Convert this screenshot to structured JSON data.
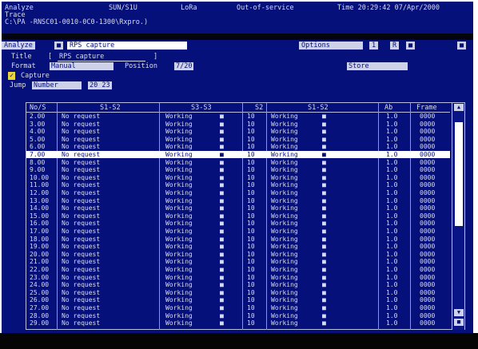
{
  "status": {
    "mode": "Analyze",
    "product": "SUN/S1U",
    "lcd": "LoRa",
    "service": "Out-of-service",
    "time": "Time 20:29:42 07/Apr/2000"
  },
  "trace": {
    "label": "Trace",
    "path": "C:\\PA -RNSC01-0010-0C0-1300\\Rxpro.)"
  },
  "control": {
    "analyze_label": "Analyze",
    "analyze_value": "RPS capture",
    "r_label": "R",
    "options_label": "Options",
    "page_label": "1",
    "title_label": "Title",
    "title_value": "RPS capture",
    "format_label": "Format",
    "format_value": "Manual",
    "position_label": "Position",
    "position_value": "7/20",
    "store_label": "Store",
    "capture_icon": "checkbox-icon",
    "capture_label": "Capture",
    "jump_label": "Jump",
    "jump_value": "Number",
    "jump_number": "20 23"
  },
  "table": {
    "headers": [
      "No/S",
      "S1-S2",
      "S3-S3",
      "S2",
      "S1-S2",
      "Ab",
      "Frame"
    ],
    "rows": [
      {
        "no": "2.00",
        "msg": "No request",
        "st1": "Working",
        "s2": "10",
        "st2": "Working",
        "ab": "1.0",
        "frame": "0000"
      },
      {
        "no": "3.00",
        "msg": "No request",
        "st1": "Working",
        "s2": "10",
        "st2": "Working",
        "ab": "1.0",
        "frame": "0000"
      },
      {
        "no": "4.00",
        "msg": "No request",
        "st1": "Working",
        "s2": "10",
        "st2": "Working",
        "ab": "1.0",
        "frame": "0000"
      },
      {
        "no": "5.00",
        "msg": "No request",
        "st1": "Working",
        "s2": "10",
        "st2": "Working",
        "ab": "1.0",
        "frame": "0000"
      },
      {
        "no": "6.00",
        "msg": "No request",
        "st1": "Working",
        "s2": "10",
        "st2": "Working",
        "ab": "1.0",
        "frame": "0000"
      },
      {
        "no": "7.00",
        "msg": "No request",
        "st1": "Working",
        "s2": "10",
        "st2": "Working",
        "ab": "1.0",
        "frame": "0000",
        "selected": true
      },
      {
        "no": "8.00",
        "msg": "No request",
        "st1": "Working",
        "s2": "10",
        "st2": "Working",
        "ab": "1.0",
        "frame": "0000"
      },
      {
        "no": "9.00",
        "msg": "No request",
        "st1": "Working",
        "s2": "10",
        "st2": "Working",
        "ab": "1.0",
        "frame": "0000"
      },
      {
        "no": "10.00",
        "msg": "No request",
        "st1": "Working",
        "s2": "10",
        "st2": "Working",
        "ab": "1.0",
        "frame": "0000"
      },
      {
        "no": "11.00",
        "msg": "No request",
        "st1": "Working",
        "s2": "10",
        "st2": "Working",
        "ab": "1.0",
        "frame": "0000"
      },
      {
        "no": "12.00",
        "msg": "No request",
        "st1": "Working",
        "s2": "10",
        "st2": "Working",
        "ab": "1.0",
        "frame": "0000"
      },
      {
        "no": "13.00",
        "msg": "No request",
        "st1": "Working",
        "s2": "10",
        "st2": "Working",
        "ab": "1.0",
        "frame": "0000"
      },
      {
        "no": "14.00",
        "msg": "No request",
        "st1": "Working",
        "s2": "10",
        "st2": "Working",
        "ab": "1.0",
        "frame": "0000"
      },
      {
        "no": "15.00",
        "msg": "No request",
        "st1": "Working",
        "s2": "10",
        "st2": "Working",
        "ab": "1.0",
        "frame": "0000"
      },
      {
        "no": "16.00",
        "msg": "No request",
        "st1": "Working",
        "s2": "10",
        "st2": "Working",
        "ab": "1.0",
        "frame": "0000"
      },
      {
        "no": "17.00",
        "msg": "No request",
        "st1": "Working",
        "s2": "10",
        "st2": "Working",
        "ab": "1.0",
        "frame": "0000"
      },
      {
        "no": "18.00",
        "msg": "No request",
        "st1": "Working",
        "s2": "10",
        "st2": "Working",
        "ab": "1.0",
        "frame": "0000"
      },
      {
        "no": "19.00",
        "msg": "No request",
        "st1": "Working",
        "s2": "10",
        "st2": "Working",
        "ab": "1.0",
        "frame": "0000"
      },
      {
        "no": "20.00",
        "msg": "No request",
        "st1": "Working",
        "s2": "10",
        "st2": "Working",
        "ab": "1.0",
        "frame": "0000"
      },
      {
        "no": "21.00",
        "msg": "No request",
        "st1": "Working",
        "s2": "10",
        "st2": "Working",
        "ab": "1.0",
        "frame": "0000"
      },
      {
        "no": "22.00",
        "msg": "No request",
        "st1": "Working",
        "s2": "10",
        "st2": "Working",
        "ab": "1.0",
        "frame": "0000"
      },
      {
        "no": "23.00",
        "msg": "No request",
        "st1": "Working",
        "s2": "10",
        "st2": "Working",
        "ab": "1.0",
        "frame": "0000"
      },
      {
        "no": "24.00",
        "msg": "No request",
        "st1": "Working",
        "s2": "10",
        "st2": "Working",
        "ab": "1.0",
        "frame": "0000"
      },
      {
        "no": "25.00",
        "msg": "No request",
        "st1": "Working",
        "s2": "10",
        "st2": "Working",
        "ab": "1.0",
        "frame": "0000"
      },
      {
        "no": "26.00",
        "msg": "No request",
        "st1": "Working",
        "s2": "10",
        "st2": "Working",
        "ab": "1.0",
        "frame": "0000"
      },
      {
        "no": "27.00",
        "msg": "No request",
        "st1": "Working",
        "s2": "10",
        "st2": "Working",
        "ab": "1.0",
        "frame": "0000"
      },
      {
        "no": "28.00",
        "msg": "No request",
        "st1": "Working",
        "s2": "10",
        "st2": "Working",
        "ab": "1.0",
        "frame": "0000"
      },
      {
        "no": "29.00",
        "msg": "No request",
        "st1": "Working",
        "s2": "10",
        "st2": "Working",
        "ab": "1.0",
        "frame": "0000"
      }
    ]
  },
  "scrollbar": {
    "up_icon": "arrow-up-icon",
    "down_icon": "arrow-down-icon"
  },
  "colors": {
    "screen_bg": "#06107a",
    "text": "#d8dcf0",
    "highlight": "#cdd2e8",
    "selected_row": "#ffffff"
  }
}
